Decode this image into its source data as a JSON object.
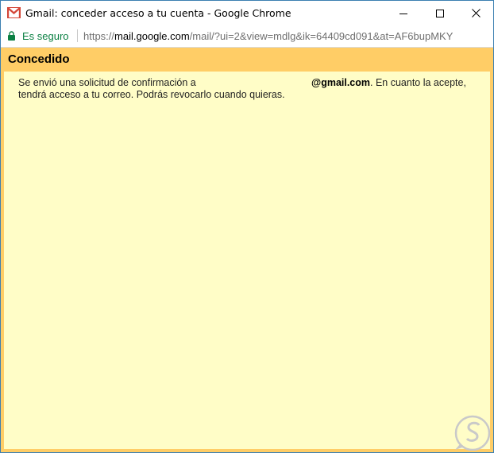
{
  "window": {
    "title": "Gmail: conceder acceso a tu cuenta - Google Chrome",
    "controls": {
      "minimize": "minimize-icon",
      "maximize": "maximize-icon",
      "close": "close-icon"
    }
  },
  "addressbar": {
    "secure_label": "Es seguro",
    "url_scheme": "https://",
    "url_host": "mail.google.com",
    "url_rest": "/mail/?ui=2&view=mdlg&ik=64409cd091&at=AF6bupMKY"
  },
  "content": {
    "heading": "Concedido",
    "message_line1_start": "Se envió una solicitud de confirmación a",
    "email_domain": "@gmail.com",
    "message_line1_end": ". En cuanto la acepte,",
    "message_line2": "tendrá acceso a tu correo. Podrás revocarlo cuando quieras."
  },
  "colors": {
    "header": "#ffcd66",
    "background": "#fffdc7",
    "secure_green": "#0b8043",
    "window_border": "#3c7fb1"
  }
}
